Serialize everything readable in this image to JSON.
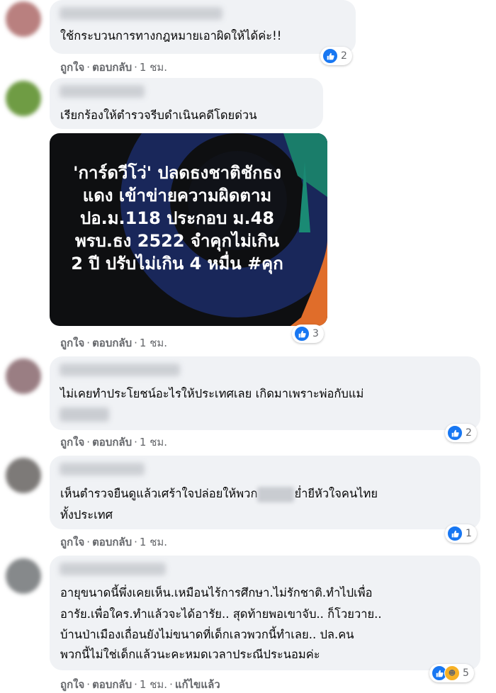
{
  "actions": {
    "like": "ถูกใจ",
    "sep": "·",
    "reply": "ตอบกลับ",
    "time": "1 ชม.",
    "edited": "แก้ไขแล้ว"
  },
  "comments": [
    {
      "text": [
        "ใช้กระบวนการทางกฎหมายเอาผิดให้ได้ค่ะ!!"
      ],
      "reaction_count": "2"
    },
    {
      "text": [
        "เรียกร้องให้ตำรวจรีบดำเนินคดีโดยด่วน"
      ],
      "reaction_count": "3",
      "image_text": [
        "'การ์ดวีโว่' ปลดธงชาติชักธง",
        "แดง เข้าข่ายความผิดตาม",
        "ปอ.ม.118 ประกอบ ม.48",
        "พรบ.ธง 2522 จำคุกไม่เกิน",
        "2 ปี ปรับไม่เกิน 4 หมื่น #คุก"
      ]
    },
    {
      "text": [
        "ไม่เคยทำประโยชน์อะไรให้ประเทศเลย เกิดมาเพราะพ่อกับแม่"
      ],
      "reaction_count": "2"
    },
    {
      "text": [
        "เห็นตำรวจยืนดูแล้วเศร้าใจปล่อยให้พวก",
        "ย่ำยีหัวใจคนไทย",
        "ทั้งประเทศ"
      ],
      "reaction_count": "1"
    },
    {
      "text": [
        "อายุขนาดนี้พึ่งเคยเห็น.เหมือนไร้การศึกษา.ไม่รักชาติ.ทำไปเพื่อ",
        "อารัย.เพื่อใคร.ทำแล้วจะได้อารัย.. สุดท้ายพอเขาจับ.. ก็โวยวาย..",
        "บ้านป่าเมืองเถื่อนยังไม่ขนาดที่เด็กเลวพวกนี้ทำเลย.. ปล.คน",
        "พวกนี้ไม่ใช่เด็กแล้วนะคะหมดเวลาประณีประนอมค่ะ"
      ],
      "reaction_count": "5"
    }
  ],
  "colors": {
    "like": "#1877f2",
    "haha": "#f7b125",
    "bubble": "#f0f2f5",
    "meta": "#65676b"
  }
}
